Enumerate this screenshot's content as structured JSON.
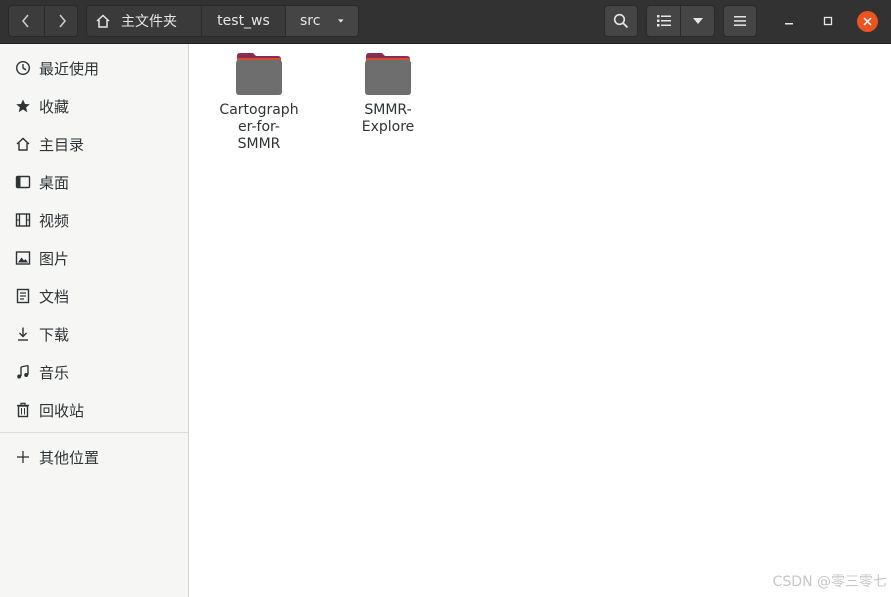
{
  "header": {
    "breadcrumbs": [
      "主文件夹",
      "test_ws",
      "src"
    ]
  },
  "sidebar": {
    "items": [
      {
        "label": "最近使用",
        "icon": "clock-icon"
      },
      {
        "label": "收藏",
        "icon": "star-icon"
      },
      {
        "label": "主目录",
        "icon": "home-icon"
      },
      {
        "label": "桌面",
        "icon": "desktop-icon"
      },
      {
        "label": "视频",
        "icon": "film-icon"
      },
      {
        "label": "图片",
        "icon": "image-icon"
      },
      {
        "label": "文档",
        "icon": "document-icon"
      },
      {
        "label": "下载",
        "icon": "download-icon"
      },
      {
        "label": "音乐",
        "icon": "music-icon"
      },
      {
        "label": "回收站",
        "icon": "trash-icon"
      }
    ],
    "other_locations": {
      "label": "其他位置",
      "icon": "plus-icon"
    }
  },
  "files": [
    {
      "name": "Cartographer-for-SMMR",
      "lines": [
        "Cartograph",
        "er-for-",
        "SMMR"
      ]
    },
    {
      "name": "SMMR-Explore",
      "lines": [
        "SMMR-",
        "Explore"
      ]
    }
  ],
  "watermark": "CSDN @零三零七",
  "colors": {
    "header_bg": "#323232",
    "close_button": "#e95420",
    "folder_body": "#6e6e6e",
    "folder_tab": "#8a2c55"
  }
}
